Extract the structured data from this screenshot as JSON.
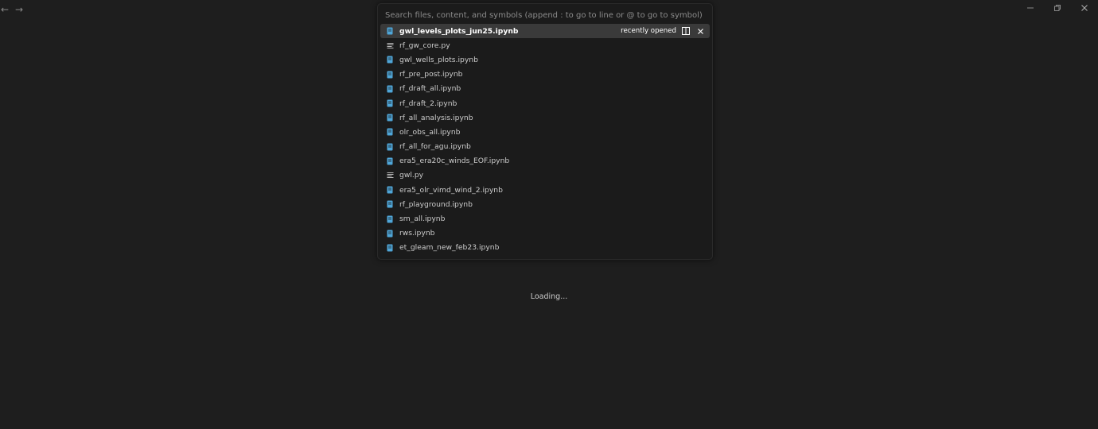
{
  "nav": {
    "back_icon": "arrow-left-icon",
    "forward_icon": "arrow-right-icon"
  },
  "window_controls": {
    "minimize_icon": "minimize-icon",
    "restore_icon": "restore-icon",
    "close_icon": "close-icon"
  },
  "quick_open": {
    "placeholder": "Search files, content, and symbols (append : to go to line or @ to go to symbol)",
    "value": "",
    "active_badge": "recently opened",
    "split_icon": "split-editor-icon",
    "remove_icon": "close-icon",
    "results": [
      {
        "label": "gwl_levels_plots_jun25.ipynb",
        "icon": "notebook-icon"
      },
      {
        "label": "rf_gw_core.py",
        "icon": "python-file-icon"
      },
      {
        "label": "gwl_wells_plots.ipynb",
        "icon": "notebook-icon"
      },
      {
        "label": "rf_pre_post.ipynb",
        "icon": "notebook-icon"
      },
      {
        "label": "rf_draft_all.ipynb",
        "icon": "notebook-icon"
      },
      {
        "label": "rf_draft_2.ipynb",
        "icon": "notebook-icon"
      },
      {
        "label": "rf_all_analysis.ipynb",
        "icon": "notebook-icon"
      },
      {
        "label": "olr_obs_all.ipynb",
        "icon": "notebook-icon"
      },
      {
        "label": "rf_all_for_agu.ipynb",
        "icon": "notebook-icon"
      },
      {
        "label": "era5_era20c_winds_EOF.ipynb",
        "icon": "notebook-icon"
      },
      {
        "label": "gwl.py",
        "icon": "python-file-icon"
      },
      {
        "label": "era5_olr_vimd_wind_2.ipynb",
        "icon": "notebook-icon"
      },
      {
        "label": "rf_playground.ipynb",
        "icon": "notebook-icon"
      },
      {
        "label": "sm_all.ipynb",
        "icon": "notebook-icon"
      },
      {
        "label": "rws.ipynb",
        "icon": "notebook-icon"
      },
      {
        "label": "et_gleam_new_feb23.ipynb",
        "icon": "notebook-icon"
      }
    ]
  },
  "status": {
    "loading": "Loading..."
  },
  "colors": {
    "notebook_icon": "#4fa6d8",
    "list_icon": "#bbbbbb",
    "background": "#1e1e1e",
    "active_row": "#3a3a3a"
  }
}
